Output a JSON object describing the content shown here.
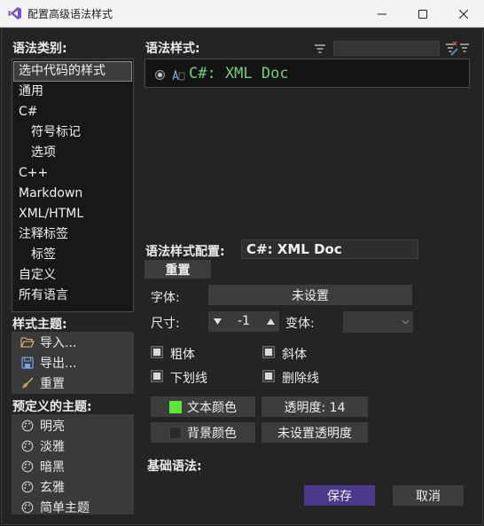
{
  "window": {
    "title": "配置高级语法样式"
  },
  "left": {
    "categories_label": "语法类别:",
    "categories": [
      {
        "label": "选中代码的样式",
        "selected": true,
        "sub": false
      },
      {
        "label": "通用",
        "selected": false,
        "sub": false
      },
      {
        "label": "C#",
        "selected": false,
        "sub": false
      },
      {
        "label": "符号标记",
        "selected": false,
        "sub": true
      },
      {
        "label": "选项",
        "selected": false,
        "sub": true
      },
      {
        "label": "C++",
        "selected": false,
        "sub": false
      },
      {
        "label": "Markdown",
        "selected": false,
        "sub": false
      },
      {
        "label": "XML/HTML",
        "selected": false,
        "sub": false
      },
      {
        "label": "注释标签",
        "selected": false,
        "sub": false
      },
      {
        "label": "标签",
        "selected": false,
        "sub": true
      },
      {
        "label": "自定义",
        "selected": false,
        "sub": false
      },
      {
        "label": "所有语言",
        "selected": false,
        "sub": false
      }
    ],
    "theme_label": "样式主题:",
    "theme_actions": [
      {
        "label": "导入...",
        "icon": "folder-open-icon"
      },
      {
        "label": "导出...",
        "icon": "save-icon"
      },
      {
        "label": "重置",
        "icon": "broom-icon"
      }
    ],
    "preset_label": "预定义的主题:",
    "presets": [
      {
        "label": "明亮",
        "icon": "palette-icon"
      },
      {
        "label": "淡雅",
        "icon": "palette-icon"
      },
      {
        "label": "暗黑",
        "icon": "palette-icon"
      },
      {
        "label": "玄雅",
        "icon": "palette-icon"
      },
      {
        "label": "简单主题",
        "icon": "palette-icon"
      }
    ]
  },
  "right": {
    "styles_label": "语法样式:",
    "style_search": {
      "value": "",
      "placeholder": ""
    },
    "style_entry": {
      "label": "C#: XML Doc",
      "color": "#6cd07f"
    },
    "config_label": "语法样式配置:",
    "config_name": "C#: XML Doc",
    "reset_label": "重置",
    "font_label": "字体:",
    "font_value": "未设置",
    "size_label": "尺寸:",
    "size_value": "-1",
    "variant_label": "变体:",
    "variant_value": "",
    "bold_label": "粗体",
    "italic_label": "斜体",
    "underline_label": "下划线",
    "strikethrough_label": "删除线",
    "text_color_label": "文本颜色",
    "text_color": "#5ee63c",
    "opacity_label": "透明度: 14",
    "bg_color_label": "背景颜色",
    "bg_color": "#2a2a2a",
    "no_opacity_label": "未设置透明度",
    "base_syntax_label": "基础语法:",
    "save_label": "保存",
    "cancel_label": "取消"
  }
}
